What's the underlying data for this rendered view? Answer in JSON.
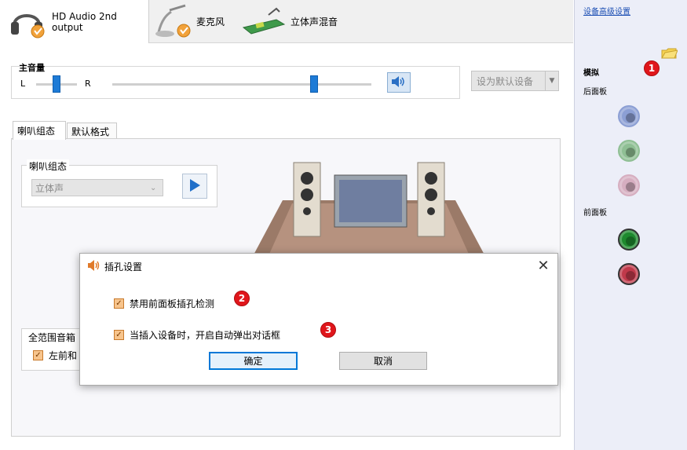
{
  "tabs": [
    {
      "label": "HD Audio 2nd output",
      "icon": "headphones-icon",
      "active": true
    },
    {
      "label": "麦克风",
      "icon": "microphone-icon",
      "active": false
    },
    {
      "label": "立体声混音",
      "icon": "sound-card-icon",
      "active": false
    }
  ],
  "volume": {
    "title": "主音量",
    "left_label": "L",
    "right_label": "R",
    "balance_level": 0.5,
    "master_level": 0.78,
    "mute_icon": "speaker-icon"
  },
  "default_device_button": "设为默认设备",
  "inner_tabs": [
    {
      "label": "喇叭组态",
      "active": true
    },
    {
      "label": "默认格式",
      "active": false
    }
  ],
  "speaker_config": {
    "group_label": "喇叭组态",
    "selected": "立体声"
  },
  "full_range": {
    "group_label": "全范围音箱",
    "checkbox_label": "左前和"
  },
  "right_panel": {
    "link": "设备高级设置",
    "analog_label": "模拟",
    "rear_label": "后面板",
    "front_label": "前面板",
    "rear_jacks": [
      "#8c9fd4",
      "#8fbf94",
      "#d6aec0"
    ],
    "front_jacks": [
      "#1e8a2e",
      "#c1394a"
    ],
    "folder_icon": "folder-icon"
  },
  "dialog": {
    "title": "插孔设置",
    "title_icon": "speaker-icon",
    "options": [
      {
        "label": "禁用前面板插孔检测",
        "checked": true
      },
      {
        "label": "当插入设备时，开启自动弹出对话框",
        "checked": true
      }
    ],
    "ok": "确定",
    "cancel": "取消"
  },
  "badges": [
    "1",
    "2",
    "3"
  ],
  "colors": {
    "accent": "#1e7bd6",
    "badge": "#e0161b",
    "checkbox": "#f7c48c",
    "right_panel_bg": "#eceef8"
  }
}
